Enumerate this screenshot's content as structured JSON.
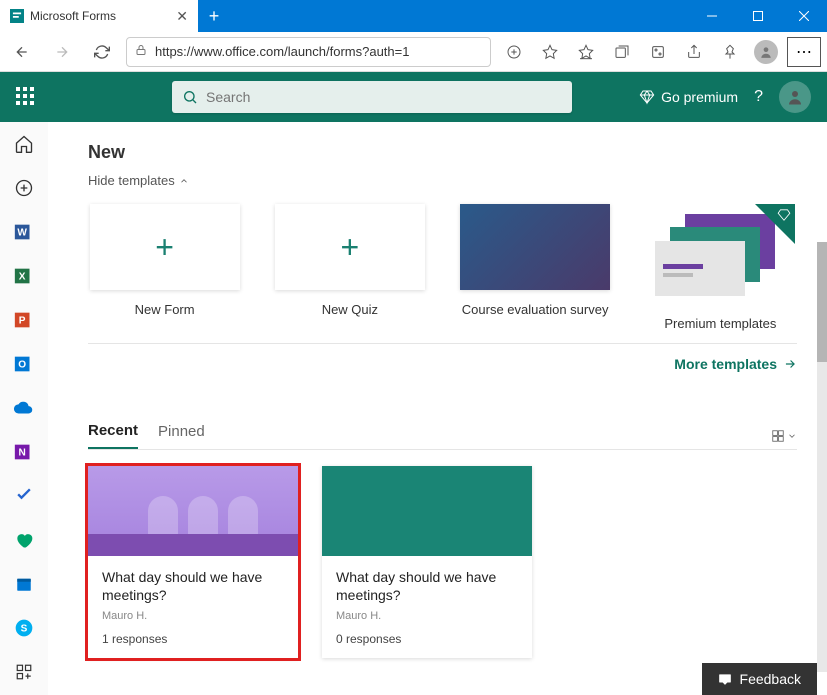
{
  "browser": {
    "tab_title": "Microsoft Forms",
    "url": "https://www.office.com/launch/forms?auth=1"
  },
  "topnav": {
    "search_placeholder": "Search",
    "premium_label": "Go premium",
    "help_label": "?"
  },
  "main": {
    "new_heading": "New",
    "hide_templates": "Hide templates",
    "templates": [
      {
        "label": "New Form"
      },
      {
        "label": "New Quiz"
      },
      {
        "label": "Course evaluation survey"
      },
      {
        "label": "Premium templates"
      }
    ],
    "more_templates": "More templates",
    "tabs": {
      "recent": "Recent",
      "pinned": "Pinned"
    },
    "cards": [
      {
        "title": "What day should we have meetings?",
        "author": "Mauro H.",
        "responses": "1 responses"
      },
      {
        "title": "What day should we have meetings?",
        "author": "Mauro H.",
        "responses": "0 responses"
      }
    ],
    "feedback": "Feedback"
  }
}
